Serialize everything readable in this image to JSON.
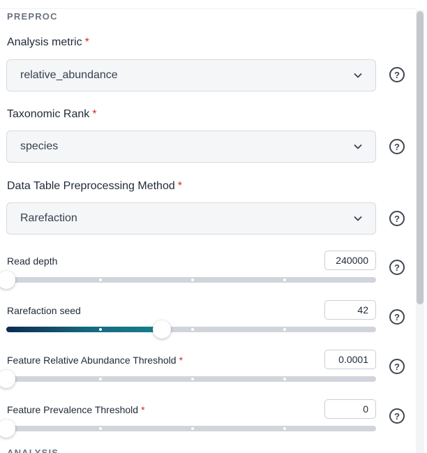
{
  "section": {
    "title": "PREPROC",
    "next_title": "ANALYSIS"
  },
  "colors": {
    "required": "#dc2626",
    "slider_fill_start": "#0d2b52",
    "slider_fill_end": "#17818a",
    "track": "#d1d5db"
  },
  "fields": {
    "analysis_metric": {
      "label": "Analysis metric",
      "required": "*",
      "value": "relative_abundance",
      "help_icon": "question-circle-icon",
      "help_glyph": "?"
    },
    "taxonomic_rank": {
      "label": "Taxonomic Rank",
      "required": "*",
      "value": "species",
      "help_icon": "question-circle-icon",
      "help_glyph": "?"
    },
    "preprocessing_method": {
      "label": "Data Table Preprocessing Method",
      "required": "*",
      "value": "Rarefaction",
      "help_icon": "question-circle-icon",
      "help_glyph": "?"
    }
  },
  "sliders": {
    "read_depth": {
      "label": "Read depth",
      "required": "",
      "value": "240000",
      "position": 0.0,
      "help_glyph": "?"
    },
    "rarefaction_seed": {
      "label": "Rarefaction seed",
      "required": "",
      "value": "42",
      "position": 0.42,
      "help_glyph": "?"
    },
    "feature_rel_abundance": {
      "label": "Feature Relative Abundance Threshold",
      "required": "*",
      "value": "0.0001",
      "position": 0.0,
      "help_glyph": "?"
    },
    "feature_prevalence": {
      "label": "Feature Prevalence Threshold",
      "required": "*",
      "value": "0",
      "position": 0.0,
      "help_glyph": "?"
    }
  }
}
